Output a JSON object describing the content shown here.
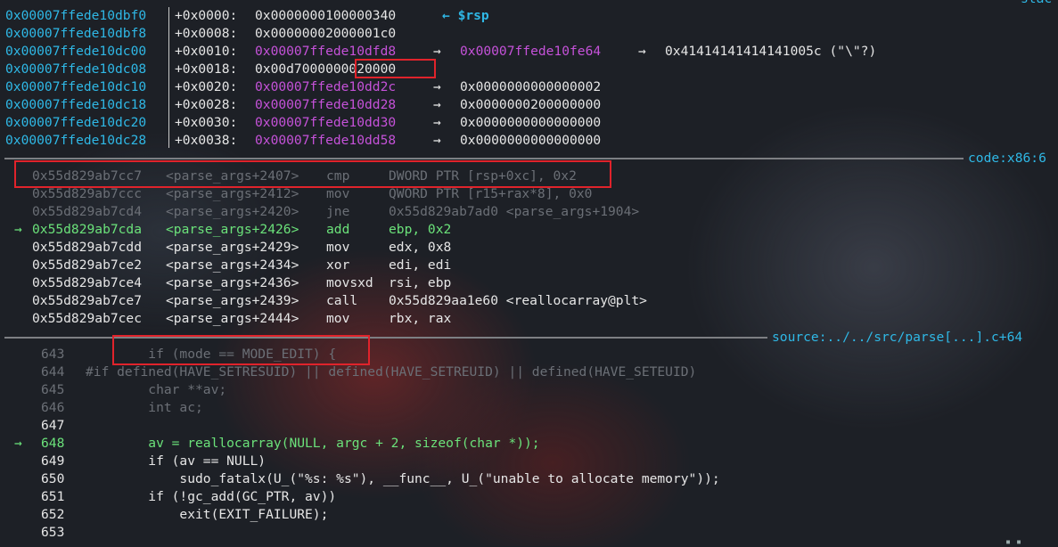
{
  "header": {
    "stack_label": "stac"
  },
  "stack": {
    "rows": [
      {
        "address": "0x00007ffede10dbf0",
        "offset": "+0x0000:",
        "value": "0x0000000100000340",
        "arrow1": "",
        "target": "",
        "arrow2": "",
        "deref": "",
        "marker": "← $rsp"
      },
      {
        "address": "0x00007ffede10dbf8",
        "offset": "+0x0008:",
        "value": "0x00000002000001c0",
        "arrow1": "",
        "target": "",
        "arrow2": "",
        "deref": "",
        "marker": ""
      },
      {
        "address": "0x00007ffede10dc00",
        "offset": "+0x0010:",
        "value": "0x00007ffede10dfd8",
        "arrow1": "→",
        "target": "0x00007ffede10fe64",
        "arrow2": "→",
        "deref": "0x41414141414141005c (\"\\\"?)",
        "marker": ""
      },
      {
        "address": "0x00007ffede10dc08",
        "offset": "+0x0018:",
        "value": "0x00d7000000020000",
        "arrow1": "",
        "target": "",
        "arrow2": "",
        "deref": "",
        "marker": ""
      },
      {
        "address": "0x00007ffede10dc10",
        "offset": "+0x0020:",
        "value": "0x00007ffede10dd2c",
        "arrow1": "→",
        "target": "0x0000000000000002",
        "arrow2": "",
        "deref": "",
        "marker": ""
      },
      {
        "address": "0x00007ffede10dc18",
        "offset": "+0x0028:",
        "value": "0x00007ffede10dd28",
        "arrow1": "→",
        "target": "0x0000000200000000",
        "arrow2": "",
        "deref": "",
        "marker": ""
      },
      {
        "address": "0x00007ffede10dc20",
        "offset": "+0x0030:",
        "value": "0x00007ffede10dd30",
        "arrow1": "→",
        "target": "0x0000000000000000",
        "arrow2": "",
        "deref": "",
        "marker": ""
      },
      {
        "address": "0x00007ffede10dc28",
        "offset": "+0x0038:",
        "value": "0x00007ffede10dd58",
        "arrow1": "→",
        "target": "0x0000000000000000",
        "arrow2": "",
        "deref": "",
        "marker": ""
      }
    ]
  },
  "code": {
    "title": "code:x86:6",
    "rows": [
      {
        "pointer": "",
        "address": "0x55d829ab7cc7",
        "symbol": "<parse_args+2407>",
        "mnemonic": "cmp",
        "operands": "DWORD PTR [rsp+0xc], 0x2"
      },
      {
        "pointer": "",
        "address": "0x55d829ab7ccc",
        "symbol": "<parse_args+2412>",
        "mnemonic": "mov",
        "operands": "QWORD PTR [r15+rax*8], 0x0"
      },
      {
        "pointer": "",
        "address": "0x55d829ab7cd4",
        "symbol": "<parse_args+2420>",
        "mnemonic": "jne",
        "operands": "0x55d829ab7ad0 <parse_args+1904>"
      },
      {
        "pointer": "→",
        "address": "0x55d829ab7cda",
        "symbol": "<parse_args+2426>",
        "mnemonic": "add",
        "operands": "ebp, 0x2"
      },
      {
        "pointer": "",
        "address": "0x55d829ab7cdd",
        "symbol": "<parse_args+2429>",
        "mnemonic": "mov",
        "operands": "edx, 0x8"
      },
      {
        "pointer": "",
        "address": "0x55d829ab7ce2",
        "symbol": "<parse_args+2434>",
        "mnemonic": "xor",
        "operands": "edi, edi"
      },
      {
        "pointer": "",
        "address": "0x55d829ab7ce4",
        "symbol": "<parse_args+2436>",
        "mnemonic": "movsxd",
        "operands": "rsi, ebp"
      },
      {
        "pointer": "",
        "address": "0x55d829ab7ce7",
        "symbol": "<parse_args+2439>",
        "mnemonic": "call",
        "operands": "0x55d829aa1e60 <reallocarray@plt>"
      },
      {
        "pointer": "",
        "address": "0x55d829ab7cec",
        "symbol": "<parse_args+2444>",
        "mnemonic": "mov",
        "operands": "rbx, rax"
      }
    ]
  },
  "source": {
    "title": "source:../../src/parse[...].c+64",
    "rows": [
      {
        "pointer": "",
        "line": "643",
        "text": "        if (mode == MODE_EDIT) {"
      },
      {
        "pointer": "",
        "line": "644",
        "text": "#if defined(HAVE_SETRESUID) || defined(HAVE_SETREUID) || defined(HAVE_SETEUID)"
      },
      {
        "pointer": "",
        "line": "645",
        "text": "        char **av;"
      },
      {
        "pointer": "",
        "line": "646",
        "text": "        int ac;"
      },
      {
        "pointer": "",
        "line": "647",
        "text": ""
      },
      {
        "pointer": "→",
        "line": "648",
        "text": "        av = reallocarray(NULL, argc + 2, sizeof(char *));"
      },
      {
        "pointer": "",
        "line": "649",
        "text": "        if (av == NULL)"
      },
      {
        "pointer": "",
        "line": "650",
        "text": "            sudo_fatalx(U_(\"%s: %s\"), __func__, U_(\"unable to allocate memory\"));"
      },
      {
        "pointer": "",
        "line": "651",
        "text": "        if (!gc_add(GC_PTR, av))"
      },
      {
        "pointer": "",
        "line": "652",
        "text": "            exit(EXIT_FAILURE);"
      },
      {
        "pointer": "",
        "line": "653",
        "text": ""
      }
    ]
  },
  "colors": {
    "address": "#2fb8e6",
    "pointer_value": "#c552d9",
    "current_line": "#6be27a",
    "dim": "#6b6f76",
    "highlight_box": "#e0232b"
  }
}
